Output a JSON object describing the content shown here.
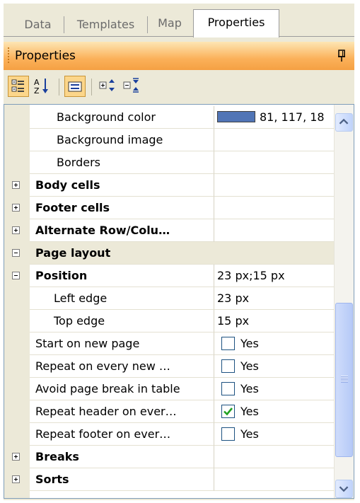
{
  "tabs": [
    {
      "label": "Data"
    },
    {
      "label": "Templates"
    },
    {
      "label": "Map"
    },
    {
      "label": "Properties"
    }
  ],
  "panel": {
    "title": "Properties",
    "pin_icon": "pin-icon"
  },
  "toolbar": {
    "categorized_icon": "categorized-view-icon",
    "alphabetical_icon": "alphabetical-sort-icon",
    "property_pages_icon": "property-pages-icon",
    "expand_icon": "expand-all-icon",
    "collapse_icon": "collapse-all-icon"
  },
  "rows": [
    {
      "name": "Background color",
      "value": "81, 117, 18",
      "swatch": "#5175b6"
    },
    {
      "name": "Background image",
      "value": ""
    },
    {
      "name": "Borders",
      "value": ""
    },
    {
      "name": "Body cells",
      "value": ""
    },
    {
      "name": "Footer cells",
      "value": ""
    },
    {
      "name": "Alternate Row/Colu…",
      "value": ""
    },
    {
      "name": "Page layout",
      "value": ""
    },
    {
      "name": "Position",
      "value": "23 px;15 px"
    },
    {
      "name": "Left edge",
      "value": "23 px"
    },
    {
      "name": "Top edge",
      "value": "15 px"
    },
    {
      "name": "Start on new page",
      "value": "Yes",
      "checked": false
    },
    {
      "name": "Repeat on every new …",
      "value": "Yes",
      "checked": false
    },
    {
      "name": "Avoid page break in table",
      "value": "Yes",
      "checked": false
    },
    {
      "name": "Repeat header on ever…",
      "value": "Yes",
      "checked": true
    },
    {
      "name": "Repeat footer on ever…",
      "value": "Yes",
      "checked": false
    },
    {
      "name": "Breaks",
      "value": ""
    },
    {
      "name": "Sorts",
      "value": ""
    }
  ],
  "colors": {
    "title_bar": "#fbb15a",
    "swatch": "#5175b6",
    "checkmark": "#21a121"
  }
}
